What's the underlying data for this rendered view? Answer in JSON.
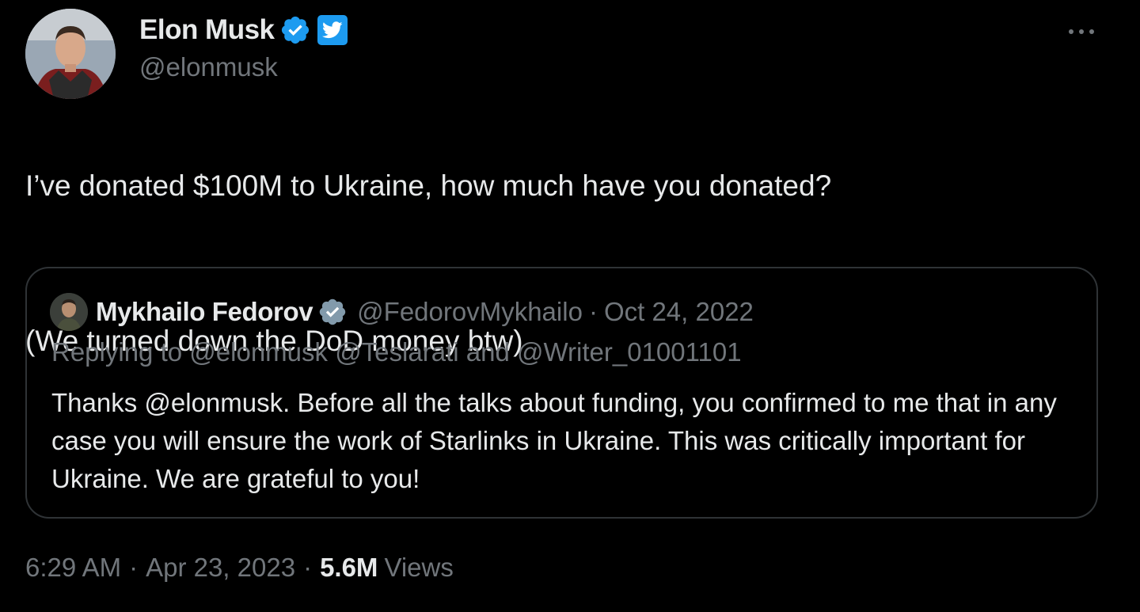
{
  "author": {
    "display_name": "Elon Musk",
    "handle": "@elonmusk"
  },
  "tweet": {
    "line1": "I’ve donated $100M to Ukraine, how much have you donated?",
    "line2": "(We turned down the DoD money btw)"
  },
  "quote": {
    "display_name": "Mykhailo Fedorov",
    "handle": "@FedorovMykhailo",
    "dot": "·",
    "date": "Oct 24, 2022",
    "replying_prefix": "Replying to",
    "reply_handle_1": "@elonmusk",
    "reply_handle_2": "@Teslarati",
    "reply_and": "and",
    "reply_handle_3": "@Writer_01001101",
    "text": "Thanks @elonmusk. Before all the talks about funding, you confirmed to me that in any case you will ensure the work of Starlinks in Ukraine. This was critically important for Ukraine. We are grateful to you!"
  },
  "meta": {
    "time": "6:29 AM",
    "sep1": "·",
    "date": "Apr 23, 2023",
    "sep2": "·",
    "views_count": "5.6M",
    "views_label": "Views"
  },
  "colors": {
    "background": "#000000",
    "text_primary": "#e7e9ea",
    "text_secondary": "#71767b",
    "border": "#2f3336",
    "verified_blue": "#1d9bf0",
    "verified_gray": "#829aab"
  },
  "icons": {
    "verified": "verified-badge-icon",
    "twitter": "twitter-bird-icon",
    "more": "more-dots-icon"
  }
}
